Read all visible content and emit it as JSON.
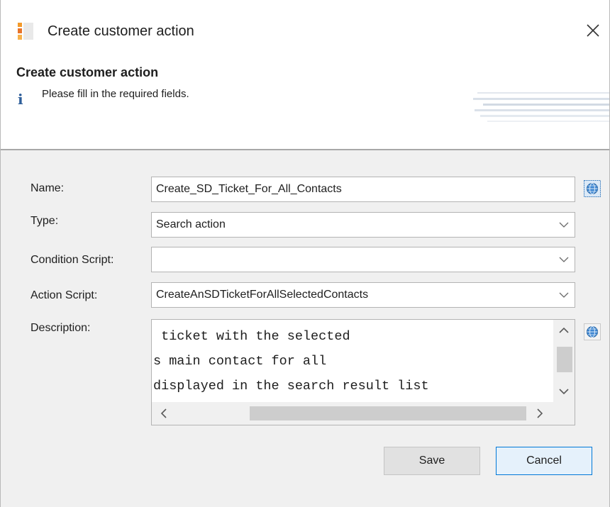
{
  "window": {
    "title": "Create customer action",
    "app_icon": "application-logo-icon",
    "close_icon": "close-icon"
  },
  "header": {
    "title": "Create customer action",
    "info_icon": "info-icon",
    "message": "Please fill in the required fields."
  },
  "form": {
    "name": {
      "label": "Name:",
      "value": "Create_SD_Ticket_For_All_Contacts"
    },
    "type": {
      "label": "Type:",
      "value": "Search action"
    },
    "condition_script": {
      "label": "Condition Script:",
      "value": ""
    },
    "action_script": {
      "label": "Action Script:",
      "value": "CreateAnSDTicketForAllSelectedContacts"
    },
    "description": {
      "label": "Description:",
      "lines": [
        " ticket with the selected",
        "s main contact for all",
        "displayed in the search result list"
      ]
    },
    "translate_icon": "globe-icon"
  },
  "buttons": {
    "save": "Save",
    "cancel": "Cancel"
  },
  "colors": {
    "form_background": "#f0f0f0",
    "default_button_border": "#0078d7",
    "default_button_fill": "#e5f1fb",
    "info_icon": "#2f5f9a"
  }
}
